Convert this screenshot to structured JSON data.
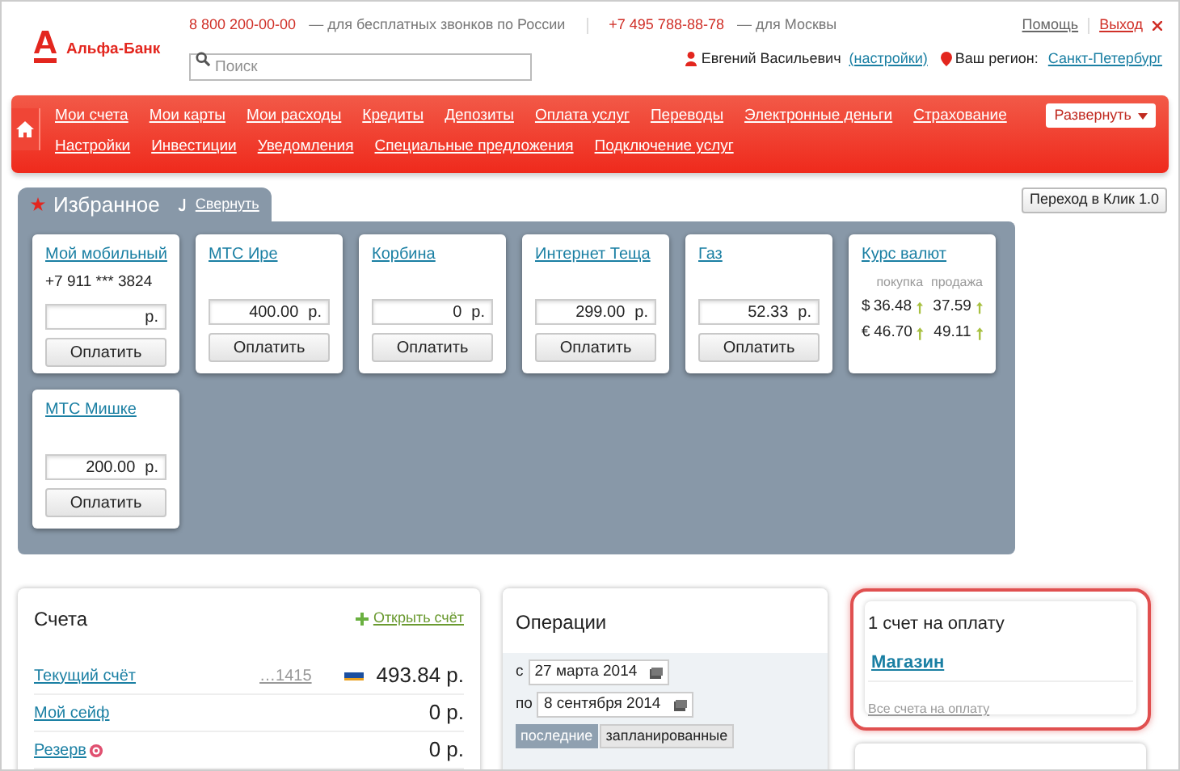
{
  "header": {
    "brand": "Альфа-Банк",
    "phones": [
      {
        "number": "8 800 200-00-00",
        "note": "— для бесплатных звонков по России"
      },
      {
        "number": "+7 495 788-88-78",
        "note": "— для Москвы"
      }
    ],
    "search": {
      "placeholder": "Поиск"
    },
    "links": [
      "Помощь",
      "Выход"
    ],
    "user": {
      "name": "Евгений Васильевич",
      "settings": "(настройки)"
    },
    "region": {
      "label": "Ваш регион:",
      "value": "Санкт-Петербург"
    }
  },
  "nav": {
    "top_links": [
      "Мои счета",
      "Мои карты",
      "Мои расходы",
      "Кредиты",
      "Депозиты",
      "Оплата услуг",
      "Переводы",
      "Электронные деньги",
      "Страхование"
    ],
    "bottom_links": [
      "Настройки",
      "Инвестиции",
      "Уведомления",
      "Специальные предложения",
      "Подключение услуг"
    ],
    "expand": "Развернуть"
  },
  "classic_button": "Переход в Клик 1.0",
  "favorites": {
    "title": "Избранное",
    "collapse": "Свернуть",
    "cards": [
      {
        "kind": "payment",
        "title": "Мой мобильный",
        "subtitle": "+7 911 *** 3824",
        "currency": "р.",
        "pay_label": "Оплатить"
      },
      {
        "kind": "payment",
        "title": "МТС Ире",
        "amount": "400.00",
        "currency": "р.",
        "pay_label": "Оплатить"
      },
      {
        "kind": "payment",
        "title": "Корбина",
        "amount": "0",
        "currency": "р.",
        "pay_label": "Оплатить"
      },
      {
        "kind": "payment",
        "title": "Интернет Теща",
        "amount": "299.00",
        "currency": "р.",
        "pay_label": "Оплатить"
      },
      {
        "kind": "payment",
        "title": "Газ",
        "amount": "52.33",
        "currency": "р.",
        "pay_label": "Оплатить"
      },
      {
        "kind": "rates",
        "title": "Курс валют",
        "columns": [
          "покупка",
          "продажа"
        ],
        "rates": [
          {
            "currency": "$",
            "buy": "36.48",
            "sell": "37.59"
          },
          {
            "currency": "€",
            "buy": "46.70",
            "sell": "49.11"
          }
        ]
      },
      {
        "kind": "payment",
        "title": "МТС Мишке",
        "amount": "200.00",
        "currency": "р.",
        "pay_label": "Оплатить"
      }
    ]
  },
  "accounts": {
    "title": "Счета",
    "open_link": "Открыть счёт",
    "rows": [
      {
        "name": "Текущий счёт",
        "number": "…1415",
        "visa": true,
        "balance": "493.84 р."
      },
      {
        "name": "Мой сейф",
        "visa": false,
        "balance": "0 р."
      },
      {
        "name": "Резерв",
        "visa": false,
        "target": true,
        "balance": "0 р."
      }
    ]
  },
  "operations": {
    "title": "Операции",
    "from_label": "с",
    "from": "27 марта 2014",
    "to_label": "по",
    "to": "8 сентября 2014",
    "tabs": [
      {
        "label": "последние",
        "selected": true
      },
      {
        "label": "запланированные",
        "selected": false
      }
    ]
  },
  "invoices": {
    "title": "1 счет на оплату",
    "items": [
      "Магазин"
    ],
    "all_link": "Все счета на оплату",
    "highlighted": true
  }
}
